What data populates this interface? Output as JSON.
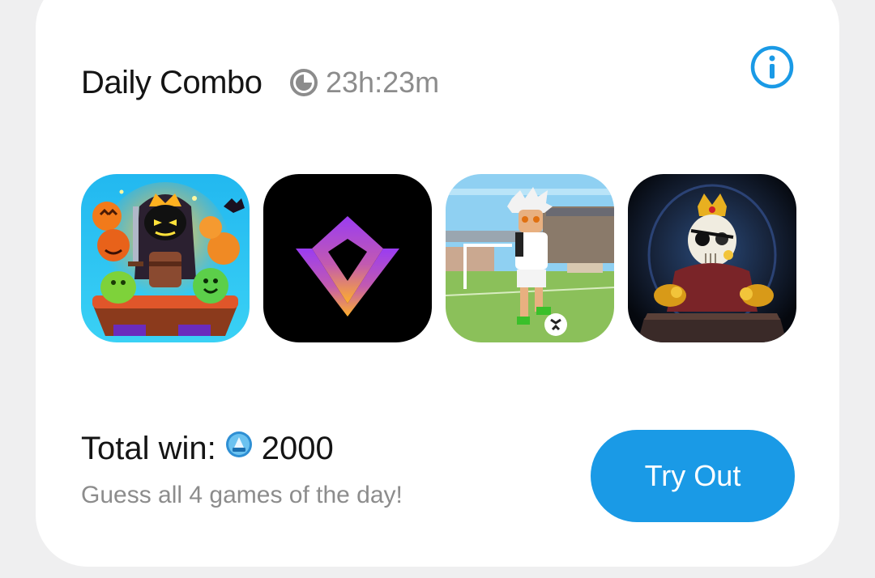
{
  "card": {
    "title": "Daily Combo",
    "timer": "23h:23m",
    "info_icon": "info-circle-icon",
    "games": [
      {
        "name": "halloween-dungeon-game-icon"
      },
      {
        "name": "purple-chevron-logo-game-icon"
      },
      {
        "name": "pixel-soccer-game-icon"
      },
      {
        "name": "skeleton-king-game-icon"
      }
    ],
    "total_label": "Total win:",
    "total_value": "2000",
    "coin_icon": "point-coin-icon",
    "subtitle": "Guess all 4 games of the day!",
    "cta_label": "Try Out"
  },
  "colors": {
    "accent": "#1a9ae6",
    "text_primary": "#141414",
    "text_secondary": "#8c8c8c",
    "background": "#efeff0"
  }
}
